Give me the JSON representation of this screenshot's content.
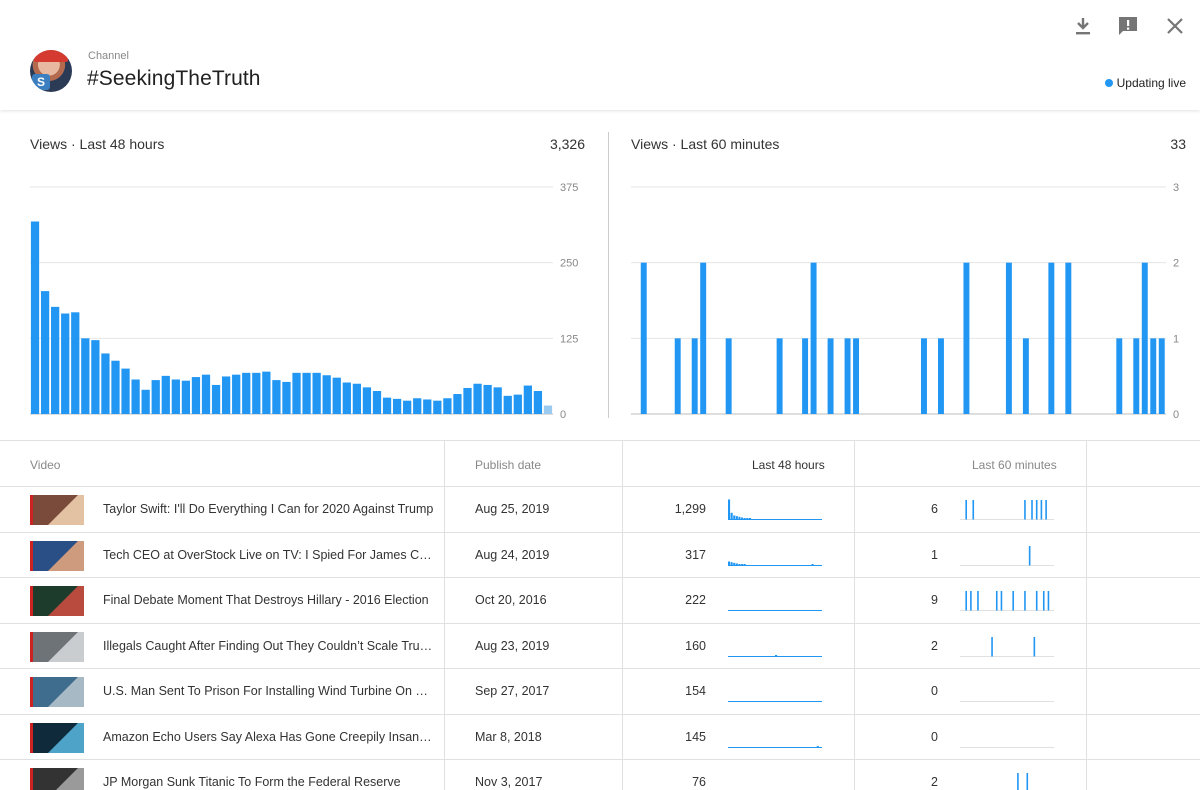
{
  "header": {
    "channel_label": "Channel",
    "channel_name": "#SeekingTheTruth",
    "avatar_badge": "S",
    "live_status": "Updating live",
    "accent_color": "#2196f3"
  },
  "icons": [
    "download-icon",
    "feedback-icon",
    "close-icon"
  ],
  "panels": {
    "left": {
      "title": "Views · Last 48 hours",
      "total": "3,326"
    },
    "right": {
      "title": "Views · Last 60 minutes",
      "total": "33"
    }
  },
  "chart_data": [
    {
      "type": "bar",
      "title": "Views · Last 48 hours",
      "ylim": [
        0,
        375
      ],
      "yticks": [
        "375",
        "250",
        "125",
        "0"
      ],
      "ytick_values": [
        375,
        250,
        125,
        0
      ],
      "values": [
        318,
        203,
        177,
        166,
        168,
        125,
        122,
        100,
        88,
        75,
        57,
        40,
        56,
        63,
        57,
        55,
        61,
        65,
        48,
        62,
        65,
        68,
        68,
        70,
        56,
        53,
        68,
        68,
        68,
        64,
        60,
        52,
        50,
        44,
        38,
        27,
        25,
        22,
        26,
        24,
        22,
        26,
        33,
        43,
        50,
        48,
        44,
        30,
        32,
        47,
        38,
        14
      ],
      "current_last": true,
      "grid": true,
      "color": "#2196f3"
    },
    {
      "type": "bar",
      "title": "Views · Last 60 minutes",
      "ylim": [
        0,
        3
      ],
      "yticks": [
        "3",
        "2",
        "1",
        "0"
      ],
      "ytick_values": [
        3,
        2,
        1,
        0
      ],
      "values": [
        0,
        2,
        0,
        0,
        0,
        1,
        0,
        1,
        2,
        0,
        0,
        1,
        0,
        0,
        0,
        0,
        0,
        1,
        0,
        0,
        1,
        2,
        0,
        1,
        0,
        1,
        1,
        0,
        0,
        0,
        0,
        0,
        0,
        0,
        1,
        0,
        1,
        0,
        0,
        2,
        0,
        0,
        0,
        0,
        2,
        0,
        1,
        0,
        0,
        2,
        0,
        2,
        0,
        0,
        0,
        0,
        0,
        1,
        0,
        1,
        2,
        1,
        1
      ],
      "grid": true,
      "color": "#2196f3"
    }
  ],
  "table": {
    "headers": {
      "video": "Video",
      "publish_date": "Publish date",
      "last48": "Last 48 hours",
      "last60": "Last 60 minutes"
    },
    "rows": [
      {
        "title": "Taylor Swift: I'll Do Everything I Can for 2020 Against Trump",
        "date": "Aug 25, 2019",
        "v48": "1,299",
        "v60": "6",
        "spark48": [
          30,
          10,
          6,
          5,
          4,
          3,
          2,
          2,
          2,
          1,
          1,
          1,
          1,
          1,
          1,
          1,
          1,
          1,
          1,
          1,
          1,
          1,
          1,
          1,
          1,
          1,
          1,
          1,
          1,
          1,
          1,
          1,
          1,
          1,
          1,
          1
        ],
        "spark60": [
          0,
          0,
          1,
          0,
          0,
          1,
          0,
          0,
          0,
          0,
          0,
          0,
          0,
          0,
          0,
          0,
          0,
          0,
          0,
          0,
          0,
          0,
          0,
          0,
          0,
          0,
          0,
          1,
          0,
          0,
          1,
          0,
          1,
          0,
          1,
          0,
          1,
          0,
          0,
          0
        ],
        "thumb": [
          "#7a4a3a",
          "#e3c2a4"
        ]
      },
      {
        "title": "Tech CEO at OverStock Live on TV: I Spied For James Com...",
        "date": "Aug 24, 2019",
        "v48": "317",
        "v60": "1",
        "spark48": [
          6,
          5,
          4,
          3,
          2,
          2,
          2,
          1,
          1,
          1,
          1,
          1,
          1,
          1,
          1,
          1,
          1,
          1,
          1,
          1,
          1,
          1,
          1,
          1,
          1,
          1,
          1,
          1,
          1,
          1,
          1,
          1,
          2,
          1,
          1,
          1
        ],
        "spark60": [
          0,
          0,
          0,
          0,
          0,
          0,
          0,
          0,
          0,
          0,
          0,
          0,
          0,
          0,
          0,
          0,
          0,
          0,
          0,
          0,
          0,
          0,
          0,
          0,
          0,
          0,
          0,
          0,
          0,
          1,
          0,
          0,
          0,
          0,
          0,
          0,
          0,
          0,
          0,
          0
        ],
        "thumb": [
          "#2a4f86",
          "#cf9b7e"
        ]
      },
      {
        "title": "Final Debate Moment That Destroys Hillary - 2016 Election",
        "date": "Oct 20, 2016",
        "v48": "222",
        "v60": "9",
        "spark48": [
          1,
          1,
          1,
          1,
          1,
          1,
          1,
          1,
          1,
          1,
          1,
          1,
          1,
          1,
          1,
          1,
          1,
          1,
          1,
          1,
          1,
          1,
          1,
          1,
          1,
          1,
          1,
          1,
          1,
          1,
          1,
          1,
          1,
          1,
          1,
          1
        ],
        "spark60": [
          0,
          0,
          1,
          0,
          1,
          0,
          0,
          1,
          0,
          0,
          0,
          0,
          0,
          0,
          0,
          1,
          0,
          1,
          0,
          0,
          0,
          0,
          1,
          0,
          0,
          0,
          0,
          1,
          0,
          0,
          0,
          0,
          1,
          0,
          0,
          1,
          0,
          1,
          0,
          0
        ],
        "thumb": [
          "#1d3c2c",
          "#b84a3e"
        ]
      },
      {
        "title": "Illegals Caught After Finding Out They Couldn’t Scale Trum...",
        "date": "Aug 23, 2019",
        "v48": "160",
        "v60": "2",
        "spark48": [
          1,
          1,
          1,
          1,
          1,
          1,
          1,
          1,
          1,
          1,
          1,
          1,
          1,
          1,
          1,
          1,
          1,
          1,
          2,
          1,
          1,
          1,
          1,
          1,
          1,
          1,
          1,
          1,
          1,
          1,
          1,
          1,
          1,
          1,
          1,
          1
        ],
        "spark60": [
          0,
          0,
          0,
          0,
          0,
          0,
          0,
          0,
          0,
          0,
          0,
          0,
          0,
          1,
          0,
          0,
          0,
          0,
          0,
          0,
          0,
          0,
          0,
          0,
          0,
          0,
          0,
          0,
          0,
          0,
          0,
          1,
          0,
          0,
          0,
          0,
          0,
          0,
          0,
          0
        ],
        "thumb": [
          "#6d7377",
          "#c9cdd0"
        ]
      },
      {
        "title": "U.S. Man Sent To Prison For Installing Wind Turbine On His ...",
        "date": "Sep 27, 2017",
        "v48": "154",
        "v60": "0",
        "spark48": [
          1,
          1,
          1,
          1,
          1,
          1,
          1,
          1,
          1,
          1,
          1,
          1,
          1,
          1,
          1,
          1,
          1,
          1,
          1,
          1,
          1,
          1,
          1,
          1,
          1,
          1,
          1,
          1,
          1,
          1,
          1,
          1,
          1,
          1,
          1,
          1
        ],
        "spark60": [
          0,
          0,
          0,
          0,
          0,
          0,
          0,
          0,
          0,
          0,
          0,
          0,
          0,
          0,
          0,
          0,
          0,
          0,
          0,
          0,
          0,
          0,
          0,
          0,
          0,
          0,
          0,
          0,
          0,
          0,
          0,
          0,
          0,
          0,
          0,
          0,
          0,
          0,
          0,
          0
        ],
        "thumb": [
          "#3f6d8e",
          "#a7b9c4"
        ]
      },
      {
        "title": "Amazon Echo Users Say Alexa Has Gone Creepily Insane w...",
        "date": "Mar 8, 2018",
        "v48": "145",
        "v60": "0",
        "spark48": [
          1,
          1,
          1,
          1,
          1,
          1,
          1,
          1,
          1,
          1,
          1,
          1,
          1,
          1,
          1,
          1,
          1,
          1,
          1,
          1,
          1,
          1,
          1,
          1,
          1,
          1,
          1,
          1,
          1,
          1,
          1,
          1,
          1,
          1,
          2,
          1
        ],
        "spark60": [
          0,
          0,
          0,
          0,
          0,
          0,
          0,
          0,
          0,
          0,
          0,
          0,
          0,
          0,
          0,
          0,
          0,
          0,
          0,
          0,
          0,
          0,
          0,
          0,
          0,
          0,
          0,
          0,
          0,
          0,
          0,
          0,
          0,
          0,
          0,
          0,
          0,
          0,
          0,
          0
        ],
        "thumb": [
          "#0f2a3a",
          "#4ea3c8"
        ]
      },
      {
        "title": "JP Morgan Sunk Titanic To Form the Federal Reserve",
        "date": "Nov 3, 2017",
        "v48": "76",
        "v60": "2",
        "spark48": [
          0,
          0,
          0,
          0,
          0,
          0,
          0,
          0,
          0,
          0,
          0,
          0,
          0,
          0,
          0,
          0,
          0,
          0,
          0,
          0,
          0,
          0,
          0,
          0,
          0,
          0,
          0,
          0,
          0,
          0,
          0,
          0,
          0,
          0,
          0,
          0
        ],
        "spark60": [
          0,
          0,
          0,
          0,
          0,
          0,
          0,
          0,
          0,
          0,
          0,
          0,
          0,
          0,
          0,
          0,
          0,
          0,
          0,
          0,
          0,
          0,
          0,
          0,
          1,
          0,
          0,
          0,
          1,
          0,
          0,
          0,
          0,
          0,
          0,
          0,
          0,
          0,
          0,
          0
        ],
        "thumb": [
          "#333333",
          "#9a9a9a"
        ]
      }
    ]
  }
}
